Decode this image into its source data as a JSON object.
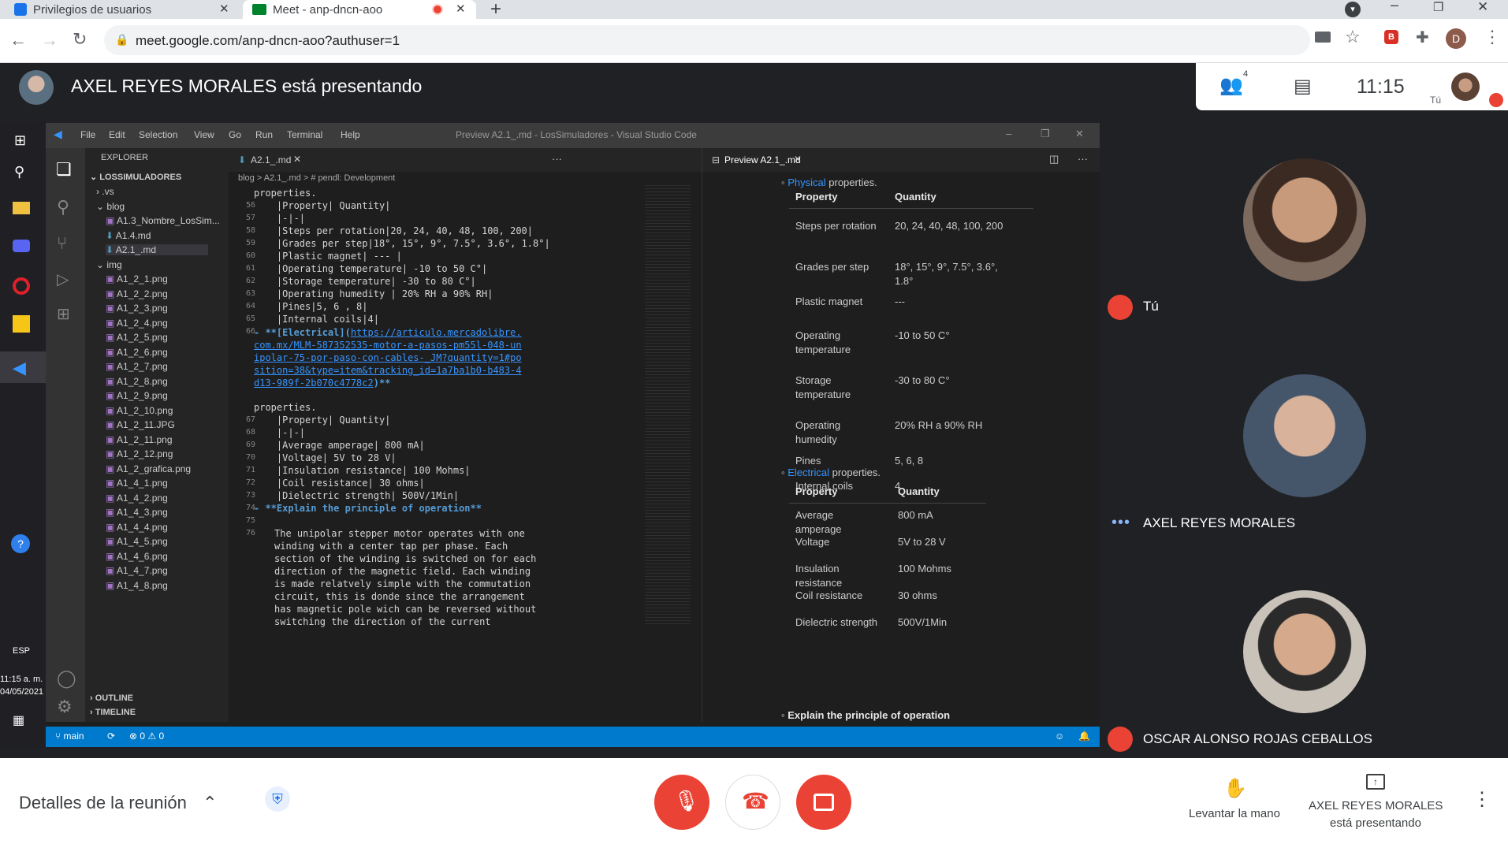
{
  "browser": {
    "tabs": [
      {
        "title": "Privilegios de usuarios"
      },
      {
        "title": "Meet - anp-dncn-aoo"
      }
    ],
    "url": "meet.google.com/anp-dncn-aoo?authuser=1",
    "profile_initial": "D"
  },
  "meet": {
    "presenting_title": "AXEL REYES MORALES está presentando",
    "participants_count": "4",
    "clock": "11:15",
    "self_label": "Tú",
    "participants": [
      {
        "name": "Tú"
      },
      {
        "name": "AXEL REYES MORALES"
      },
      {
        "name": "OSCAR ALONSO ROJAS CEBALLOS"
      }
    ],
    "details_label": "Detalles de la reunión",
    "raise_hand_label": "Levantar la mano",
    "presenting_line1": "AXEL REYES MORALES",
    "presenting_line2": "está presentando",
    "colors": {
      "red": "#ea4335",
      "accent": "#1a73e8"
    }
  },
  "vscode": {
    "menu": [
      "File",
      "Edit",
      "Selection",
      "View",
      "Go",
      "Run",
      "Terminal",
      "Help"
    ],
    "title": "Preview A2.1_.md - LosSimuladores - Visual Studio Code",
    "explorer_label": "EXPLORER",
    "root_folder": "LOSSIMULADORES",
    "tree": [
      ".vs",
      "blog",
      "A1.3_Nombre_LosSim...",
      "A1.4.md",
      "A2.1_.md",
      "img",
      "A1_2_1.png",
      "A1_2_2.png",
      "A1_2_3.png",
      "A1_2_4.png",
      "A1_2_5.png",
      "A1_2_6.png",
      "A1_2_7.png",
      "A1_2_8.png",
      "A1_2_9.png",
      "A1_2_10.png",
      "A1_2_11.JPG",
      "A1_2_11.png",
      "A1_2_12.png",
      "A1_2_grafica.png",
      "A1_4_1.png",
      "A1_4_2.png",
      "A1_4_3.png",
      "A1_4_4.png",
      "A1_4_5.png",
      "A1_4_6.png",
      "A1_4_7.png",
      "A1_4_8.png"
    ],
    "outline_label": "OUTLINE",
    "timeline_label": "TIMELINE",
    "editor_tab": "A2.1_.md",
    "breadcrumb": "blog > A2.1_.md > # pendl: Development",
    "code_lines": [
      {
        "n": "",
        "t": "properties."
      },
      {
        "n": "56",
        "t": "    |Property| Quantity|"
      },
      {
        "n": "57",
        "t": "    |-|-|"
      },
      {
        "n": "58",
        "t": "    |Steps per rotation|20, 24, 40, 48, 100, 200|"
      },
      {
        "n": "59",
        "t": "    |Grades per step|18°, 15°, 9°, 7.5°, 3.6°, 1.8°|"
      },
      {
        "n": "60",
        "t": "    |Plastic magnet| --- |"
      },
      {
        "n": "61",
        "t": "    |Operating temperature| -10 to 50 C°|"
      },
      {
        "n": "62",
        "t": "    |Storage temperature| -30 to 80 C°|"
      },
      {
        "n": "63",
        "t": "    |Operating humedity | 20% RH a 90% RH|"
      },
      {
        "n": "64",
        "t": "    |Pines|5, 6 , 8|"
      },
      {
        "n": "65",
        "t": "    |Internal coils|4|"
      }
    ],
    "code_link_prefix": "- **[Electrical](",
    "code_link": "https://articulo.mercadolibre.com.mx/MLM-587352535-motor-a-pasos-pm55l-048-unipolar-75-por-paso-con-cables-_JM?quantity=1#position=38&type=item&tracking_id=1a7ba1b0-b483-4d13-989f-2b070c4778c2",
    "code_link_suffix": ")**",
    "code_lines_2": [
      {
        "n": "",
        "t": "properties."
      },
      {
        "n": "67",
        "t": "    |Property| Quantity|"
      },
      {
        "n": "68",
        "t": "    |-|-|"
      },
      {
        "n": "69",
        "t": "    |Average amperage| 800 mA|"
      },
      {
        "n": "70",
        "t": "    |Voltage| 5V to 28 V|"
      },
      {
        "n": "71",
        "t": "    |Insulation resistance| 100 Mohms|"
      },
      {
        "n": "72",
        "t": "    |Coil resistance| 30 ohms|"
      },
      {
        "n": "73",
        "t": "    |Dielectric strength| 500V/1Min|"
      }
    ],
    "explain_line": "- **Explain the principle of operation**",
    "paragraph": [
      "The unipolar stepper motor operates with one",
      "winding with a center tap per phase. Each",
      "section of the winding is switched on for each",
      "direction of the magnetic field. Each winding",
      "is made relatvely simple with the commutation",
      "circuit, this is donde since the arrangement",
      "has magnetic pole wich can be reversed without",
      "switching the direction of the current"
    ],
    "preview_tab": "Preview A2.1_.md",
    "physical_link": "Physical",
    "physical_suffix": " properties.",
    "table_headers": [
      "Property",
      "Quantity"
    ],
    "physical_rows": [
      [
        "Steps per rotation",
        "20, 24, 40, 48, 100, 200"
      ],
      [
        "Grades per step",
        "18°, 15°, 9°, 7.5°, 3.6°, 1.8°"
      ],
      [
        "Plastic magnet",
        "---"
      ],
      [
        "Operating temperature",
        "-10 to 50 C°"
      ],
      [
        "Storage temperature",
        "-30 to 80 C°"
      ],
      [
        "Operating humedity",
        "20% RH a 90% RH"
      ],
      [
        "Pines",
        "5, 6, 8"
      ],
      [
        "Internal coils",
        "4"
      ]
    ],
    "electrical_link": "Electrical",
    "electrical_suffix": " properties.",
    "electrical_rows": [
      [
        "Average amperage",
        "800 mA"
      ],
      [
        "Voltage",
        "5V to 28 V"
      ],
      [
        "Insulation resistance",
        "100 Mohms"
      ],
      [
        "Coil resistance",
        "30 ohms"
      ],
      [
        "Dielectric strength",
        "500V/1Min"
      ]
    ],
    "preview_explain": "Explain the principle of operation",
    "status_branch": "main",
    "status_problems": "⊗ 0 ⚠ 0"
  },
  "windows": {
    "lang": "ESP",
    "time": "11:15 a. m.",
    "date": "04/05/2021"
  }
}
